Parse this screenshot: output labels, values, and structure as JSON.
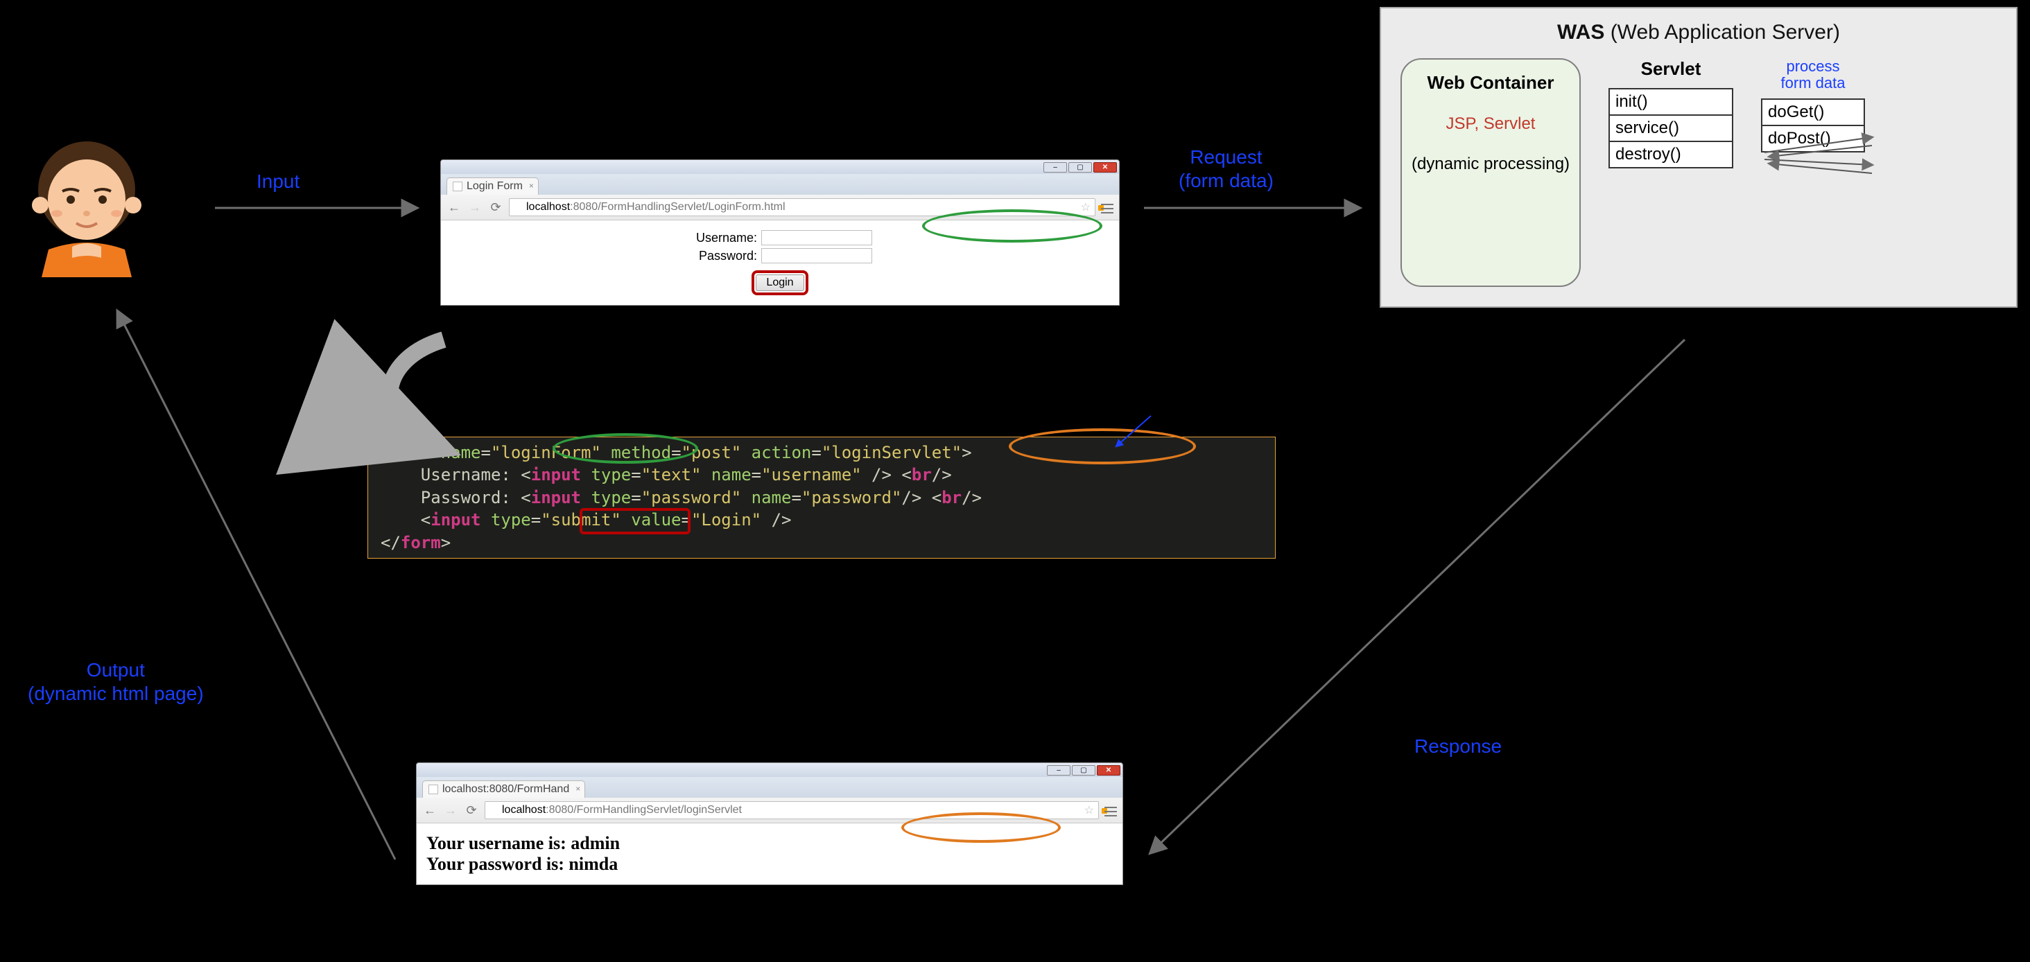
{
  "flow": {
    "input": "Input",
    "request": "Request",
    "request_sub": "(form data)",
    "response": "Response",
    "output": "Output",
    "output_sub": "(dynamic html page)"
  },
  "browser1": {
    "tab_title": "Login Form",
    "url_host": "localhost",
    "url_port": ":8080",
    "url_path": "/FormHandlingServlet/LoginForm.html",
    "form": {
      "username_label": "Username:",
      "password_label": "Password:",
      "login_button": "Login"
    }
  },
  "browser2": {
    "tab_title": "localhost:8080/FormHand",
    "url_host": "localhost",
    "url_port": ":8080",
    "url_path": "/FormHandlingServlet/loginServlet",
    "result_line1_label": "Your username is: ",
    "result_line1_value": "admin",
    "result_line2_label": "Your password is: ",
    "result_line2_value": "nimda"
  },
  "code": {
    "form_open_1": "<",
    "tag_form": "form",
    "attr_name": "name",
    "val_loginForm": "\"loginForm\"",
    "attr_method": "method",
    "val_post": "\"post\"",
    "attr_action": "action",
    "val_loginServlet": "\"loginServlet\"",
    "text_username": "    Username: ",
    "tag_input": "input",
    "attr_type": "type",
    "val_text": "\"text\"",
    "val_username": "\"username\"",
    "tag_br": "br",
    "text_password": "    Password: ",
    "val_password_type": "\"password\"",
    "val_password_name": "\"password\"",
    "val_submit": "\"submit\"",
    "attr_value": "value",
    "val_login": "\"Login\"",
    "form_close": "form"
  },
  "was": {
    "title_bold": "WAS",
    "title_rest": " (Web Application Server)",
    "webcontainer_title": "Web Container",
    "webcontainer_red": "JSP, Servlet",
    "webcontainer_desc": "(dynamic processing)",
    "servlet_title": "Servlet",
    "lifecycle": {
      "init": "init()",
      "service": "service()",
      "destroy": "destroy()"
    },
    "process_title_l1": "process",
    "process_title_l2": "form data",
    "handlers": {
      "doGet": "doGet()",
      "doPost": "doPost()"
    }
  }
}
